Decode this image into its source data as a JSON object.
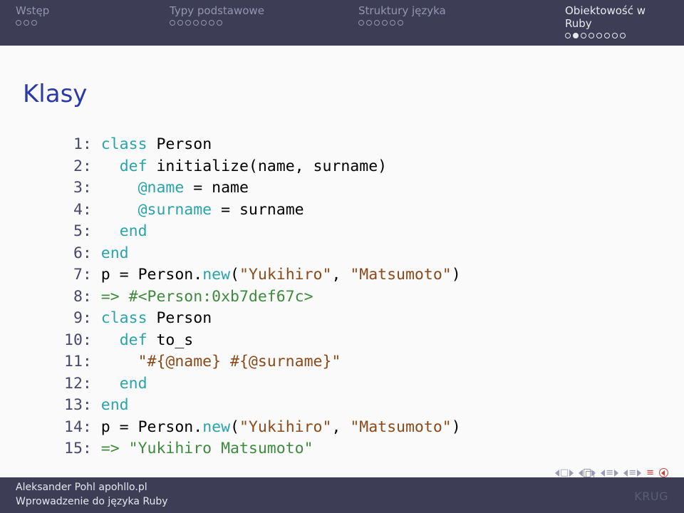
{
  "header": {
    "sections": [
      {
        "label": "Wstęp",
        "active": false,
        "dots": 3
      },
      {
        "label": "Typy podstawowe",
        "active": false,
        "dots": 7
      },
      {
        "label": "Struktury języka",
        "active": false,
        "dots": 6
      },
      {
        "label": "Obiektowość w Ruby",
        "active": true,
        "dots": 8,
        "current": 2
      }
    ]
  },
  "title": "Klasy",
  "code": {
    "l1": {
      "n": " 1:",
      "kw1": "class",
      "t1": " Person"
    },
    "l2": {
      "n": " 2:",
      "sp": "   ",
      "kw1": "def",
      "t1": " initialize(name, surname)"
    },
    "l3": {
      "n": " 3:",
      "sp": "     ",
      "v1": "@name",
      "t1": " = name"
    },
    "l4": {
      "n": " 4:",
      "sp": "     ",
      "v1": "@surname",
      "t1": " = surname"
    },
    "l5": {
      "n": " 5:",
      "sp": "   ",
      "kw1": "end"
    },
    "l6": {
      "n": " 6:",
      "sp": " ",
      "kw1": "end"
    },
    "l7": {
      "n": " 7:",
      "sp": " ",
      "t0": "p = Person.",
      "kw1": "new",
      "t1": "(",
      "s1": "\"Yukihiro\"",
      "t2": ", ",
      "s2": "\"Matsumoto\"",
      "t3": ")"
    },
    "l8": {
      "n": " 8:",
      "sp": " ",
      "r1": "=> #<Person:0xb7def67c>"
    },
    "l9": {
      "n": " 9:",
      "sp": " ",
      "kw1": "class",
      "t1": " Person"
    },
    "l10": {
      "n": "10:",
      "sp": "   ",
      "kw1": "def",
      "t1": " to_s"
    },
    "l11": {
      "n": "11:",
      "sp": "     ",
      "s1": "\"#{@name} #{@surname}\""
    },
    "l12": {
      "n": "12:",
      "sp": "   ",
      "kw1": "end"
    },
    "l13": {
      "n": "13:",
      "sp": " ",
      "kw1": "end"
    },
    "l14": {
      "n": "14:",
      "sp": " ",
      "t0": "p = Person.",
      "kw1": "new",
      "t1": "(",
      "s1": "\"Yukihiro\"",
      "t2": ", ",
      "s2": "\"Matsumoto\"",
      "t3": ")"
    },
    "l15": {
      "n": "15:",
      "sp": " ",
      "r1": "=> \"Yukihiro Matsumoto\""
    }
  },
  "footer": {
    "author": "Aleksander Pohl apohllo.pl",
    "subtitle": "Wprowadzenie do języka Ruby",
    "logo": "KRUG"
  }
}
